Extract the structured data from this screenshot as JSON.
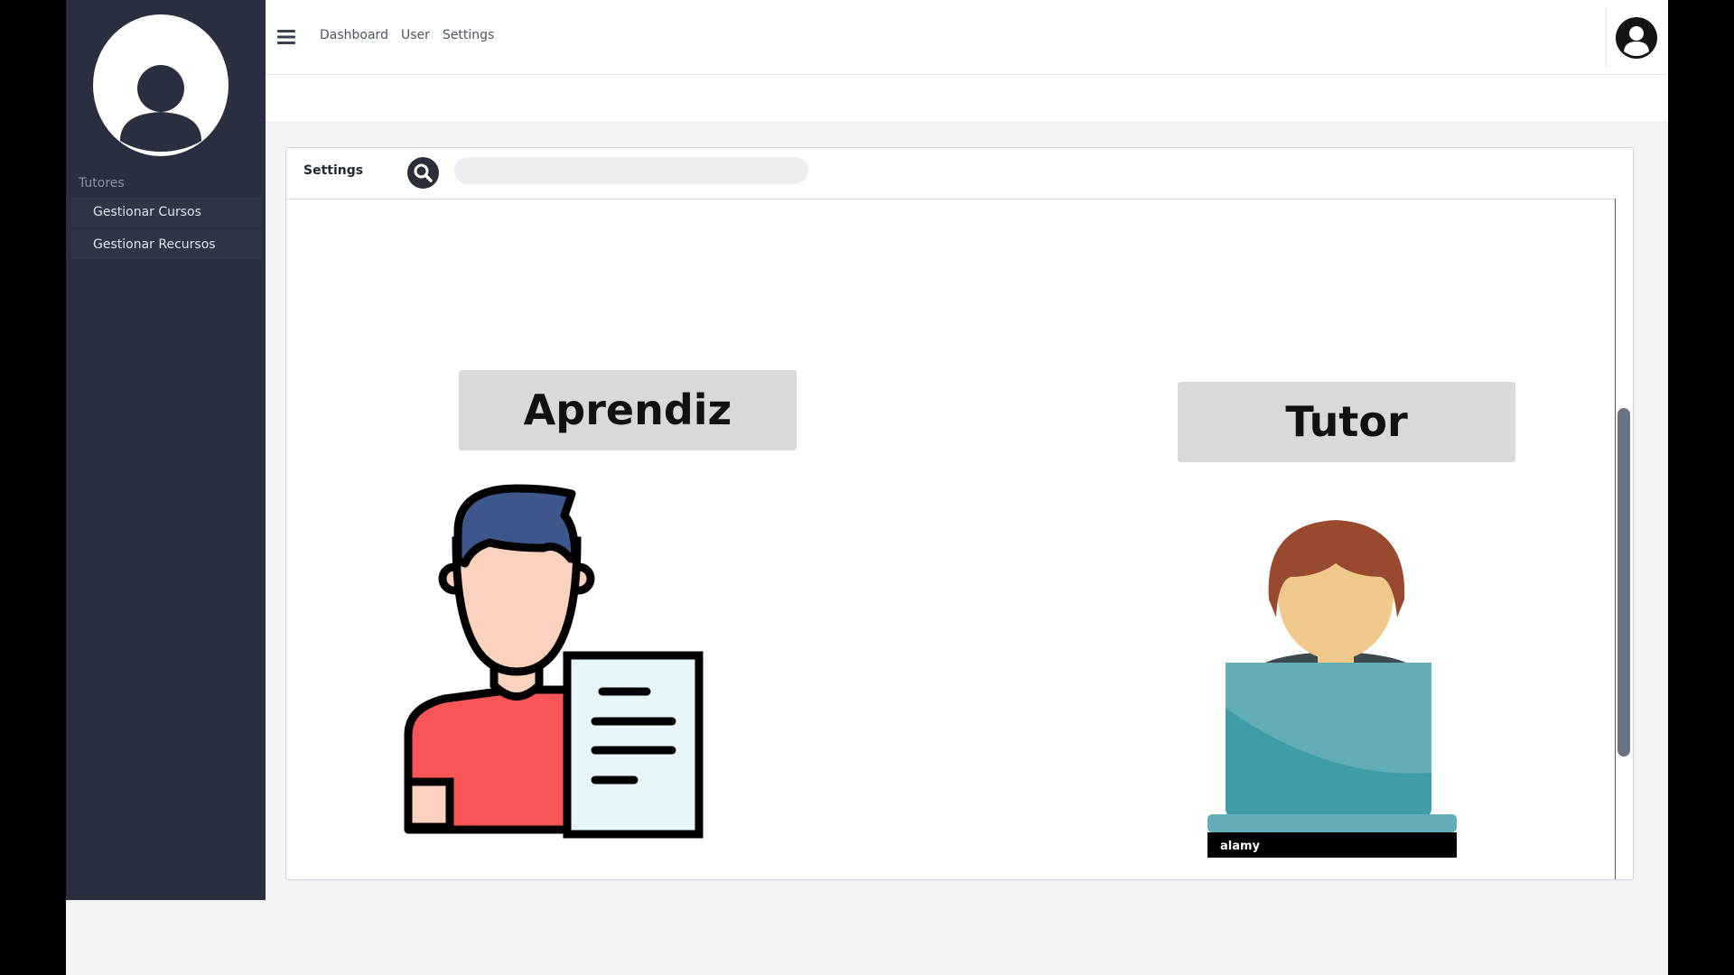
{
  "sidebar": {
    "section_label": "Tutores",
    "items": [
      {
        "label": "Gestionar Cursos"
      },
      {
        "label": "Gestionar Recursos"
      }
    ]
  },
  "topnav": {
    "links": [
      {
        "label": "Dashboard"
      },
      {
        "label": "User"
      },
      {
        "label": "Settings"
      }
    ]
  },
  "card": {
    "title": "Settings",
    "search_placeholder": ""
  },
  "roles": {
    "learner_label": "Aprendiz",
    "tutor_label": "Tutor"
  },
  "watermark": {
    "text": "alamy"
  },
  "colors": {
    "sidebar_bg": "#292f3e",
    "app_bg": "#f3f4f6",
    "button_bg": "#d9d9d9"
  },
  "icons": [
    "menu-icon",
    "search-icon",
    "user-avatar-icon"
  ]
}
